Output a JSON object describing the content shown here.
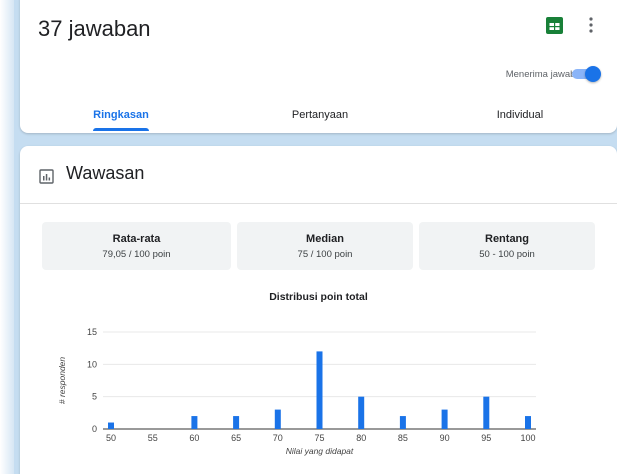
{
  "header": {
    "title": "37 jawaban",
    "accepting_label": "Menerima jawaban",
    "accepting_on": true,
    "accent_color": "#1a73e8",
    "sheets_color": "#188038"
  },
  "tabs": [
    {
      "label": "Ringkasan",
      "active": true
    },
    {
      "label": "Pertanyaan",
      "active": false
    },
    {
      "label": "Individual",
      "active": false
    }
  ],
  "insights": {
    "title": "Wawasan",
    "stats": [
      {
        "label": "Rata-rata",
        "value": "79,05 / 100 poin"
      },
      {
        "label": "Median",
        "value": "75 / 100 poin"
      },
      {
        "label": "Rentang",
        "value": "50 - 100 poin"
      }
    ]
  },
  "chart_data": {
    "type": "bar",
    "title": "Distribusi poin total",
    "xlabel": "Nilai yang didapat",
    "ylabel": "# responden",
    "categories": [
      "50",
      "55",
      "60",
      "65",
      "70",
      "75",
      "80",
      "85",
      "90",
      "95",
      "100"
    ],
    "values": [
      1,
      0,
      2,
      2,
      3,
      12,
      5,
      2,
      3,
      5,
      2
    ],
    "y_ticks": [
      "0",
      "5",
      "10",
      "15"
    ],
    "ylim": [
      0,
      15
    ],
    "grid": true,
    "bar_color": "#1a73e8"
  }
}
